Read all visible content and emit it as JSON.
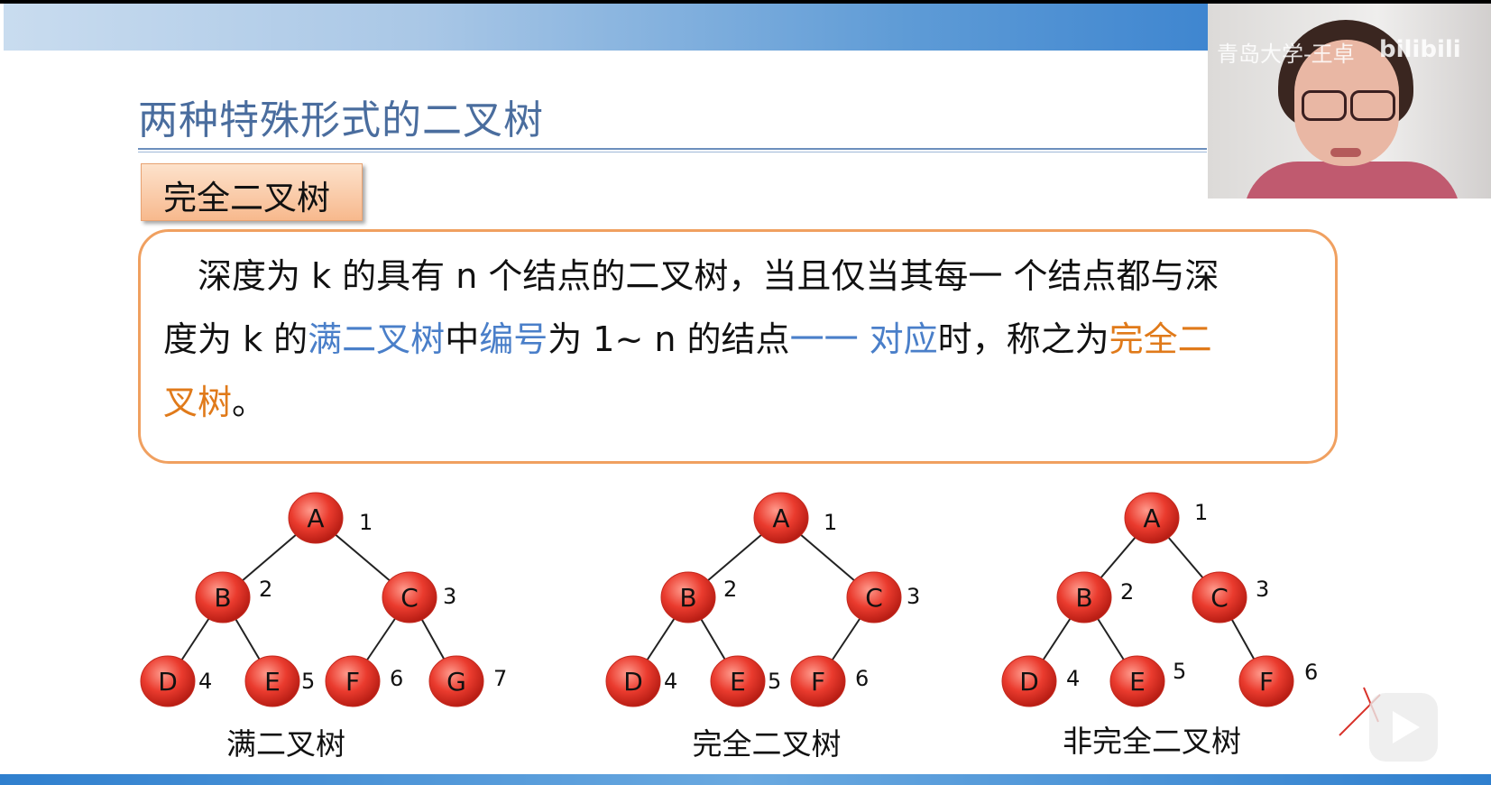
{
  "slide": {
    "title": "两种特殊形式的二叉树",
    "tag": "完全二叉树",
    "definition": {
      "line1": "深度为 k 的具有 n 个结点的二叉树，当且仅当其每一 个结点都与深",
      "line2_a": "度为 k 的",
      "line2_b": "满二叉树",
      "line2_c": "中",
      "line2_d": "编号",
      "line2_e": "为 1~ n 的结点",
      "line2_f": "一一 对应",
      "line2_g": "时，称之为",
      "line2_h": "完全二",
      "line3_a": "叉树",
      "line3_b": "。"
    }
  },
  "webcam": {
    "watermark": "青岛大学-王卓",
    "logo": "bilibili"
  },
  "trees": [
    {
      "caption": "满二叉树",
      "nodes": [
        {
          "label": "A",
          "num": "1"
        },
        {
          "label": "B",
          "num": "2"
        },
        {
          "label": "C",
          "num": "3"
        },
        {
          "label": "D",
          "num": "4"
        },
        {
          "label": "E",
          "num": "5"
        },
        {
          "label": "F",
          "num": "6"
        },
        {
          "label": "G",
          "num": "7"
        }
      ]
    },
    {
      "caption": "完全二叉树",
      "nodes": [
        {
          "label": "A",
          "num": "1"
        },
        {
          "label": "B",
          "num": "2"
        },
        {
          "label": "C",
          "num": "3"
        },
        {
          "label": "D",
          "num": "4"
        },
        {
          "label": "E",
          "num": "5"
        },
        {
          "label": "F",
          "num": "6"
        }
      ]
    },
    {
      "caption": "非完全二叉树",
      "nodes": [
        {
          "label": "A",
          "num": "1"
        },
        {
          "label": "B",
          "num": "2"
        },
        {
          "label": "C",
          "num": "3"
        },
        {
          "label": "D",
          "num": "4"
        },
        {
          "label": "E",
          "num": "5"
        },
        {
          "label": "F",
          "num": "6"
        }
      ]
    }
  ],
  "colors": {
    "title": "#4a6d9e",
    "highlight_blue": "#4a7fc9",
    "highlight_orange": "#e07a1a",
    "node_fill": "#ea3b2e",
    "box_border": "#f0a060"
  },
  "icons": [
    "play-icon"
  ]
}
